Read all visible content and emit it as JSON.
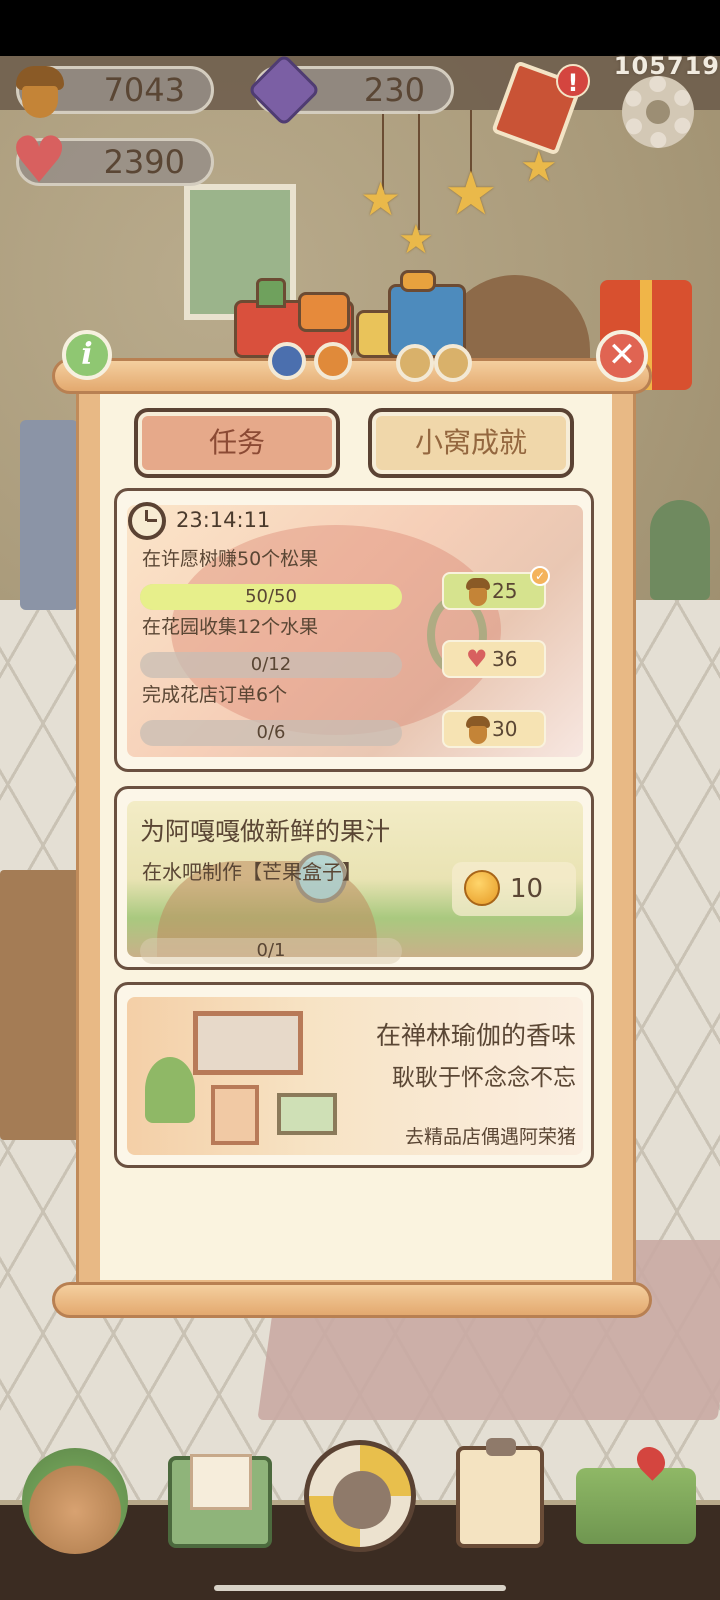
{
  "hud": {
    "acorns": "7043",
    "gems": "230",
    "hearts": "2390",
    "counter": "105719",
    "alert": "!"
  },
  "panel": {
    "info_glyph": "i",
    "close_glyph": "✕",
    "tabs": [
      {
        "label": "任务",
        "active": true
      },
      {
        "label": "小窝成就",
        "active": false
      }
    ]
  },
  "daily": {
    "timer": "23:14:11",
    "tasks": [
      {
        "title": "在许愿树赚50个松果",
        "progress": "50/50",
        "fraction": 1.0,
        "reward_type": "acorn",
        "reward": "25",
        "claimed": true
      },
      {
        "title": "在花园收集12个水果",
        "progress": "0/12",
        "fraction": 0.0,
        "reward_type": "heart",
        "reward": "36",
        "claimed": false
      },
      {
        "title": "完成花店订单6个",
        "progress": "0/6",
        "fraction": 0.0,
        "reward_type": "acorn",
        "reward": "30",
        "claimed": false
      }
    ]
  },
  "story_task": {
    "title": "为阿嘎嘎做新鲜的果汁",
    "subtitle": "在水吧制作【芒果盒子】",
    "progress": "0/1",
    "fraction": 0.0,
    "reward": "10"
  },
  "event_card": {
    "title": "在禅林瑜伽的香味",
    "subtitle": "耿耿于怀念念不忘",
    "action": "去精品店偶遇阿荣猪"
  },
  "colors": {
    "accent": "#e6a98a",
    "progress_fill": "#e7ef8b",
    "reward_bg": "#f6e3b3"
  }
}
